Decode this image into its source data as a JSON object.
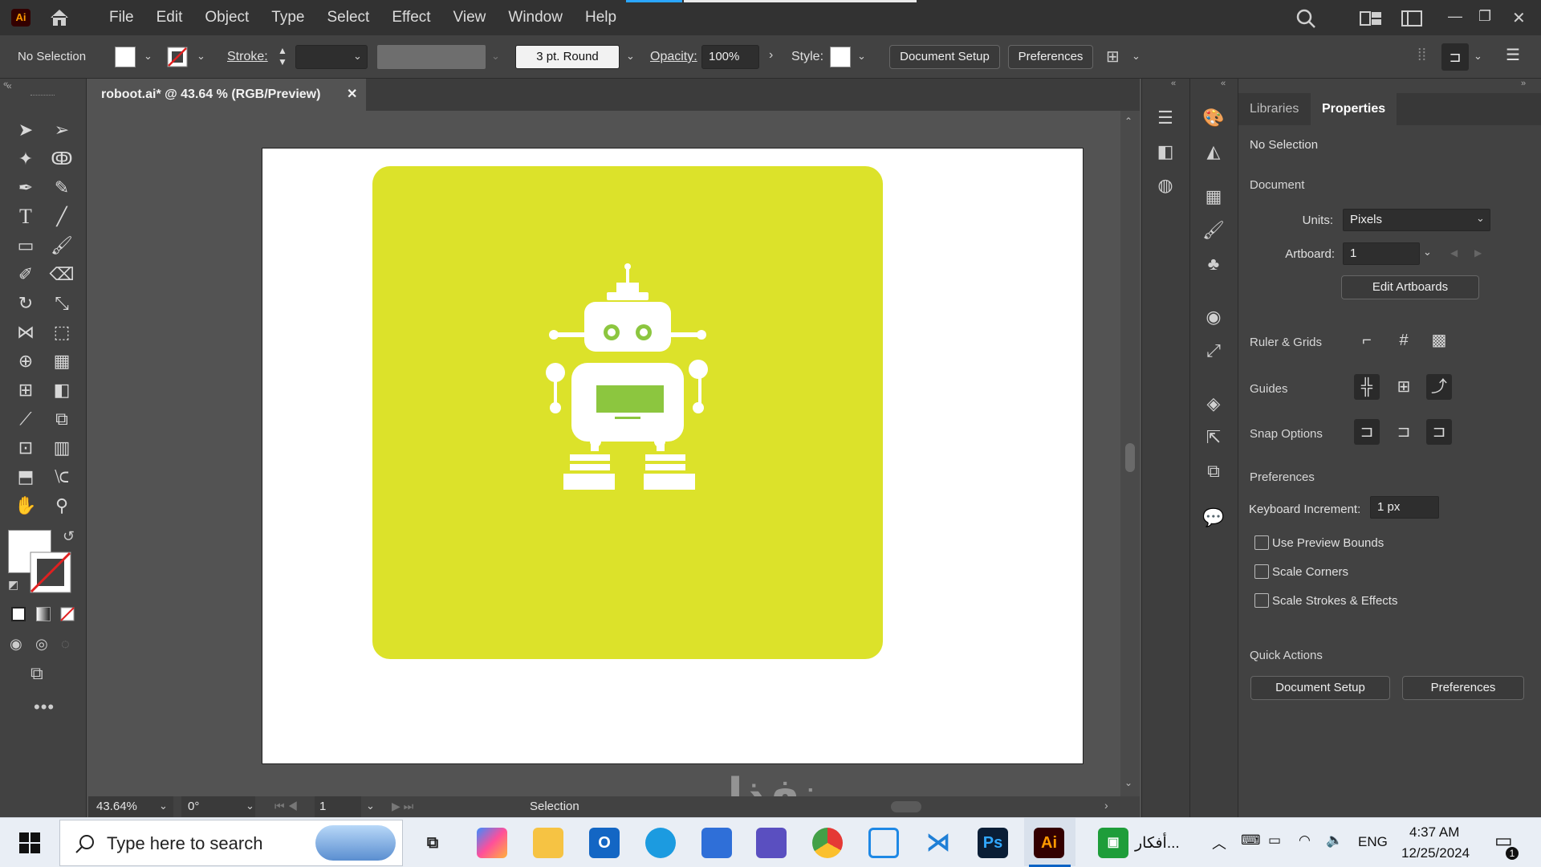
{
  "app": {
    "logo": "Ai",
    "title_tab": "roboot.ai* @ 43.64 % (RGB/Preview)"
  },
  "menu": [
    "File",
    "Edit",
    "Object",
    "Type",
    "Select",
    "Effect",
    "View",
    "Window",
    "Help"
  ],
  "control_bar": {
    "selection": "No Selection",
    "stroke_label": "Stroke:",
    "brush": "3 pt. Round",
    "opacity_label": "Opacity:",
    "opacity_value": "100%",
    "style_label": "Style:",
    "doc_setup": "Document Setup",
    "preferences": "Preferences"
  },
  "status_bar": {
    "zoom": "43.64%",
    "rotation": "0°",
    "artboard": "1",
    "tool": "Selection"
  },
  "properties": {
    "tabs": [
      "Libraries",
      "Properties"
    ],
    "active_tab": "Properties",
    "no_selection": "No Selection",
    "document": "Document",
    "units_label": "Units:",
    "units_value": "Pixels",
    "artboard_label": "Artboard:",
    "artboard_value": "1",
    "edit_artboards": "Edit Artboards",
    "ruler_grids": "Ruler & Grids",
    "guides": "Guides",
    "snap_options": "Snap Options",
    "preferences": "Preferences",
    "keyboard_increment_label": "Keyboard Increment:",
    "keyboard_increment_value": "1 px",
    "use_preview_bounds": "Use Preview Bounds",
    "scale_corners": "Scale Corners",
    "scale_strokes": "Scale Strokes & Effects",
    "quick_actions": "Quick Actions",
    "qa_doc_setup": "Document Setup",
    "qa_preferences": "Preferences"
  },
  "artwork": {
    "background_color": "#dce22a",
    "robot_color": "#ffffff",
    "accent_color": "#8cc63f"
  },
  "watermark": "نفذلي",
  "taskbar": {
    "search_placeholder": "Type here to search",
    "pinned_label": "أفكار...",
    "language": "ENG",
    "time": "4:37 AM",
    "date": "12/25/2024",
    "notification_count": "1"
  }
}
